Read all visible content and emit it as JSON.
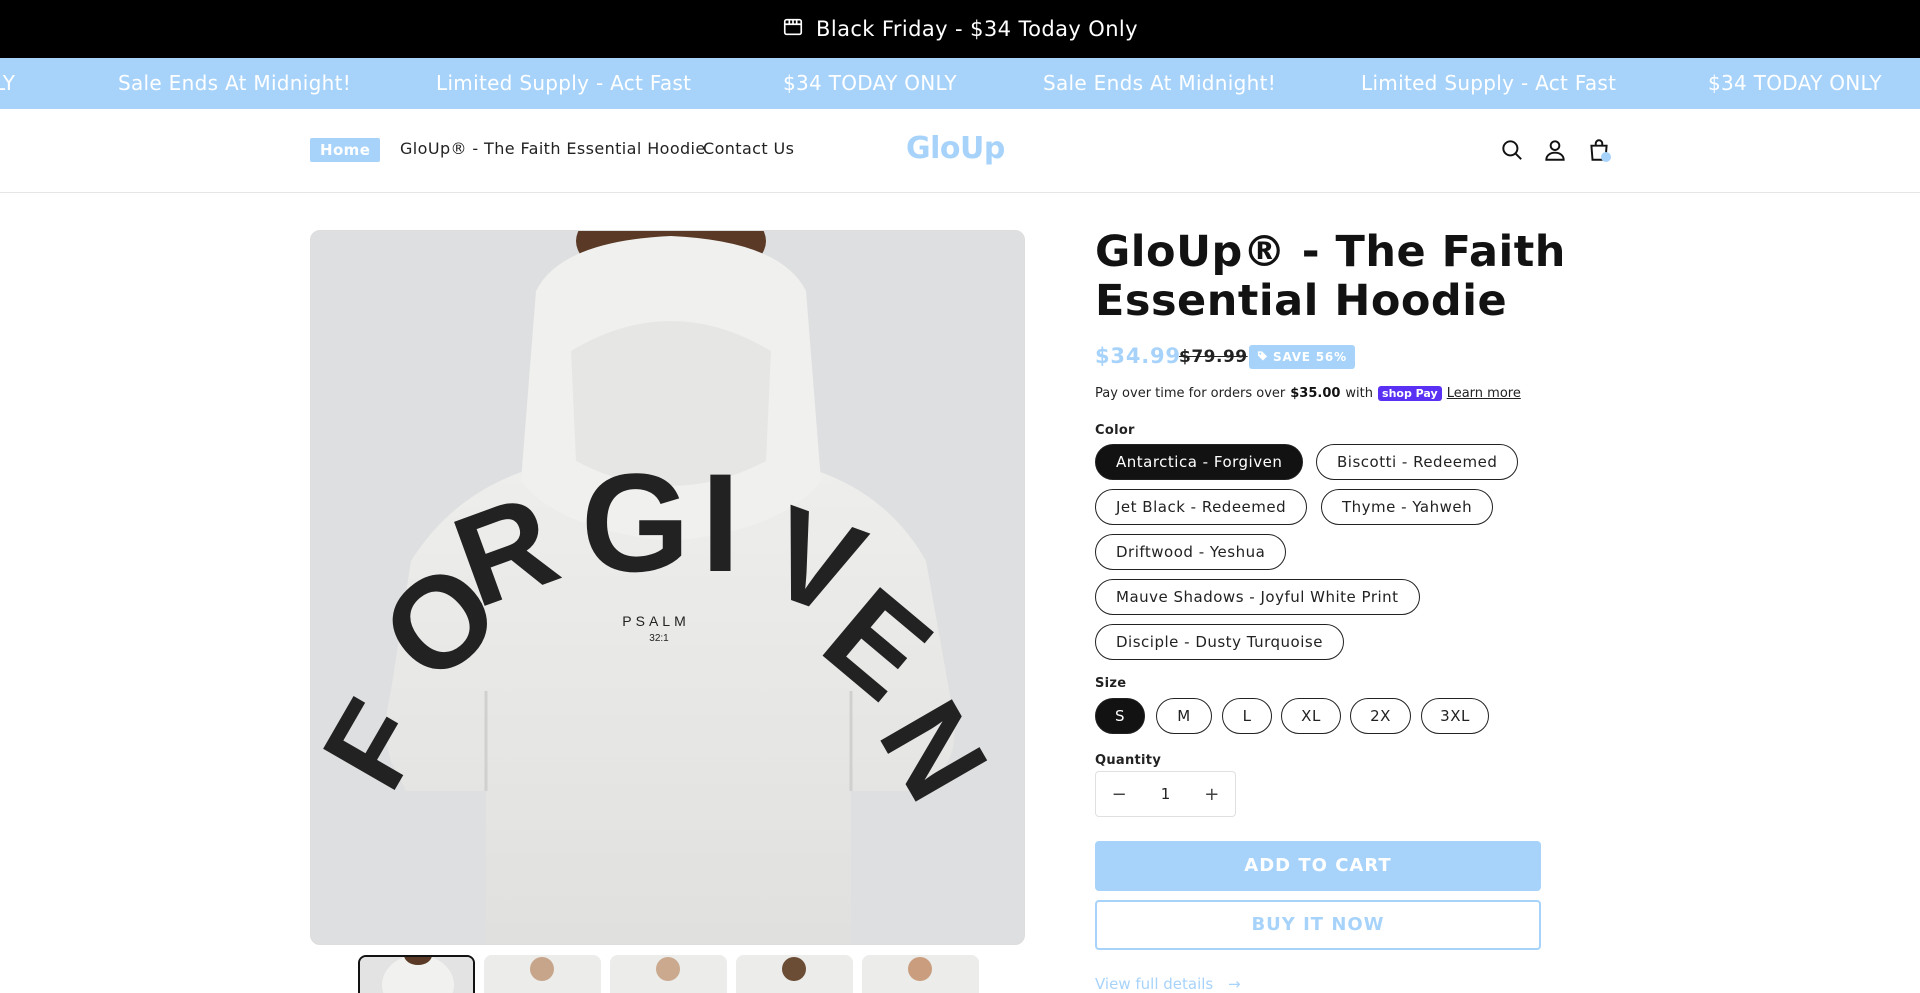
{
  "announcement": {
    "text": "Black Friday - $34 Today Only",
    "icon": "storefront-icon"
  },
  "marquee": {
    "items": [
      "LY",
      "Sale Ends At Midnight!",
      "Limited Supply - Act Fast",
      "$34 TODAY ONLY",
      "Sale Ends At Midnight!",
      "Limited Supply - Act Fast",
      "$34 TODAY ONLY"
    ]
  },
  "header": {
    "nav": [
      "Home",
      "GloUp® - The Faith Essential Hoodie",
      "Contact Us"
    ],
    "logo": "GloUp",
    "icons": [
      "search-icon",
      "account-icon",
      "cart-icon"
    ]
  },
  "product": {
    "title": "GloUp® - The Faith Essential Hoodie",
    "price": "$34.99",
    "compare_price": "$79.99",
    "save_badge": "SAVE 56%",
    "pay_over": {
      "prefix": "Pay over time for orders over",
      "amount": "$35.00",
      "with": "with",
      "brand": "shop Pay",
      "link": "Learn more"
    },
    "color_label": "Color",
    "colors": [
      "Antarctica - Forgiven",
      "Biscotti - Redeemed",
      "Jet Black - Redeemed",
      "Thyme - Yahweh",
      "Driftwood - Yeshua",
      "Mauve Shadows - Joyful White Print",
      "Disciple - Dusty Turquoise"
    ],
    "selected_color": "Antarctica - Forgiven",
    "size_label": "Size",
    "sizes": [
      "S",
      "M",
      "L",
      "XL",
      "2X",
      "3XL"
    ],
    "selected_size": "S",
    "quantity_label": "Quantity",
    "quantity": "1",
    "qty_minus": "−",
    "qty_plus": "+",
    "add_to_cart": "ADD TO CART",
    "buy_now": "BUY IT NOW",
    "view_details": "View full details",
    "view_details_arrow": "→"
  },
  "image_text": {
    "print_word": "PSALM",
    "print_verse": "32:1"
  },
  "colors": {
    "accent": "#a7d3fb",
    "dark": "#121212",
    "announce_bg": "#000000"
  }
}
